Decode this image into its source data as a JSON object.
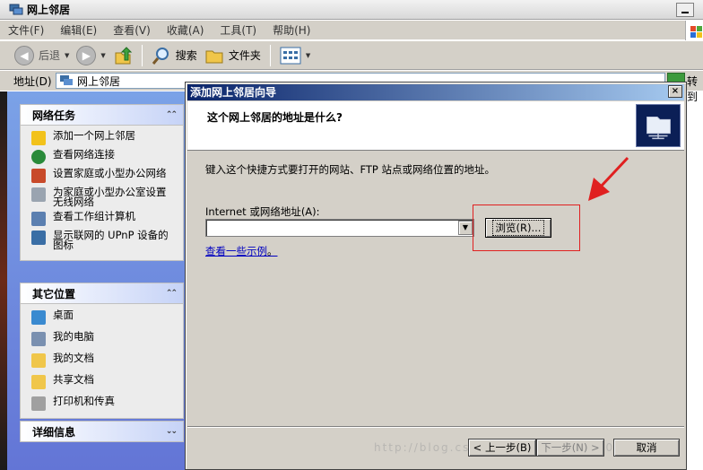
{
  "window": {
    "title": "网上邻居"
  },
  "menu": [
    "文件(F)",
    "编辑(E)",
    "查看(V)",
    "收藏(A)",
    "工具(T)",
    "帮助(H)"
  ],
  "toolbar": {
    "back": "后退",
    "search": "搜索",
    "folders": "文件夹"
  },
  "address": {
    "label": "地址(D)",
    "value": "网上邻居",
    "go": "转到"
  },
  "tasks": {
    "network": {
      "title": "网络任务",
      "items": [
        "添加一个网上邻居",
        "查看网络连接",
        "设置家庭或小型办公网络",
        "为家庭或小型办公室设置无线网络",
        "查看工作组计算机",
        "显示联网的 UPnP 设备的图标"
      ]
    },
    "other": {
      "title": "其它位置",
      "items": [
        "桌面",
        "我的电脑",
        "我的文档",
        "共享文档",
        "打印机和传真"
      ]
    },
    "details": {
      "title": "详细信息"
    }
  },
  "wizard": {
    "title": "添加网上邻居向导",
    "close": "×",
    "heading": "这个网上邻居的地址是什么?",
    "instruction": "键入这个快捷方式要打开的网站、FTP 站点或网络位置的地址。",
    "label": "Internet 或网络地址(A):",
    "input_value": "",
    "browse": "浏览(R)...",
    "examples": "查看一些示例",
    "examples_period": "。",
    "back": "< 上一步(B)",
    "next": "下一步(N) >",
    "cancel": "取消",
    "watermark": "http://blog.csdn.net/hanzheng260561728"
  },
  "colors": {
    "highlight": "#e02020",
    "title_bar": "#0a246a",
    "link": "#0000c0"
  }
}
